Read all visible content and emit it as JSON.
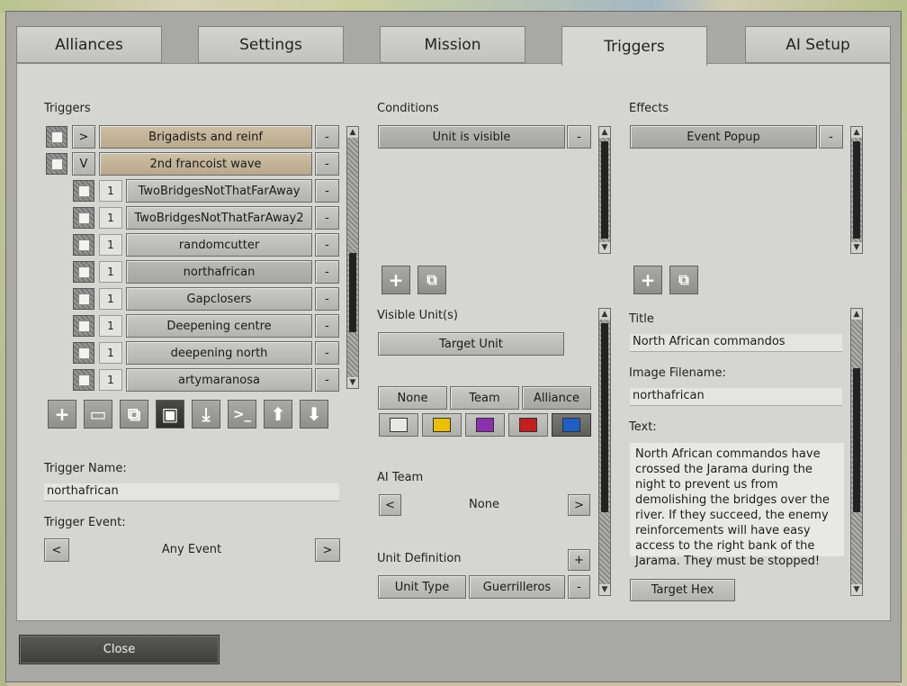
{
  "tabs": [
    "Alliances",
    "Settings",
    "Mission",
    "Triggers",
    "AI Setup"
  ],
  "triggers": {
    "heading": "Triggers",
    "groups": [
      {
        "toggle": ">",
        "label": "Brigadists and reinf"
      },
      {
        "toggle": "V",
        "label": "2nd francoist wave"
      }
    ],
    "items": [
      {
        "count": "1",
        "label": "TwoBridgesNotThatFarAway"
      },
      {
        "count": "1",
        "label": "TwoBridgesNotThatFarAway2"
      },
      {
        "count": "1",
        "label": "randomcutter"
      },
      {
        "count": "1",
        "label": "northafrican"
      },
      {
        "count": "1",
        "label": "Gapclosers"
      },
      {
        "count": "1",
        "label": "Deepening centre"
      },
      {
        "count": "1",
        "label": "deepening north"
      },
      {
        "count": "1",
        "label": "artymaranosa"
      }
    ],
    "remove_label": "-",
    "toolbar_icons": [
      "add-icon",
      "folder-icon",
      "copy-icon",
      "save-icon",
      "import-icon",
      "console-icon",
      "move-up-icon",
      "move-down-icon"
    ],
    "toolbar_glyphs": [
      "+",
      "▭",
      "⧉",
      "▣",
      "⤓",
      ">_",
      "⬆",
      "⬇"
    ]
  },
  "trigger_name": {
    "label": "Trigger Name:",
    "value": "northafrican"
  },
  "trigger_event": {
    "label": "Trigger Event:",
    "prev": "<",
    "value": "Any Event",
    "next": ">"
  },
  "conditions": {
    "heading": "Conditions",
    "items": [
      "Unit is visible"
    ],
    "remove_label": "-"
  },
  "visible_units": {
    "heading": "Visible Unit(s)",
    "target_button": "Target Unit",
    "filters": [
      "None",
      "Team",
      "Alliance"
    ],
    "selected_filter": "Alliance",
    "colors": [
      "#e8e8e8",
      "#e8c000",
      "#8a2fb0",
      "#c41e1e",
      "#1e5fc4"
    ],
    "selected_color": "#1e5fc4"
  },
  "ai_team": {
    "label": "AI Team",
    "prev": "<",
    "value": "None",
    "next": ">"
  },
  "unit_definition": {
    "label": "Unit Definition",
    "add": "+",
    "type_button": "Unit Type",
    "value": "Guerrilleros",
    "remove": "-"
  },
  "effects": {
    "heading": "Effects",
    "items": [
      "Event Popup"
    ],
    "remove_label": "-"
  },
  "popup": {
    "title_label": "Title",
    "title_value": "North African commandos",
    "image_label": "Image Filename:",
    "image_value": "northafrican",
    "text_label": "Text:",
    "text_value": "North African commandos have crossed the Jarama during the night to prevent us from demolishing the bridges over the river. If they succeed, the enemy reinforcements will have easy access to the right bank of the Jarama. They must be stopped!",
    "target_hex": "Target Hex"
  },
  "close_label": "Close",
  "colors": {
    "panel": "#d5d5d2",
    "tan_button": "#c4b498",
    "frame": "#a8a8a5"
  }
}
